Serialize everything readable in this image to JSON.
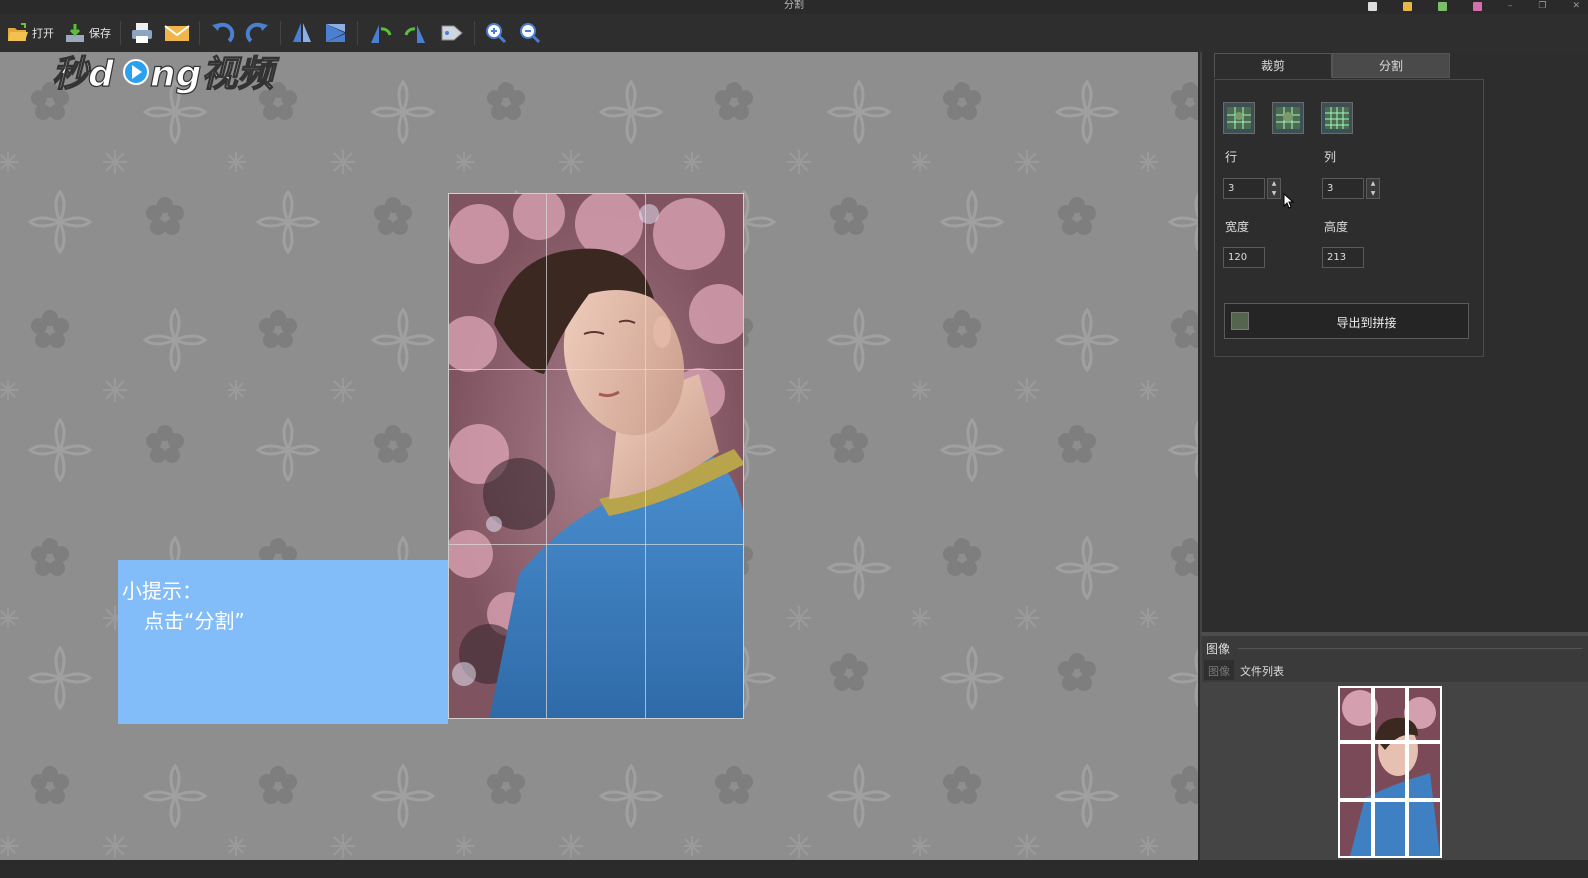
{
  "window": {
    "title": "分割"
  },
  "toolbar": {
    "open_label": "打开",
    "save_label": "保存"
  },
  "watermark": {
    "text": "秒懂视频"
  },
  "tip": {
    "title": "小提示：",
    "body": "点击“分割”"
  },
  "right_panel": {
    "tabs": [
      {
        "label": "裁剪",
        "active": true
      },
      {
        "label": "分割",
        "active": false
      }
    ],
    "rows_label": "行",
    "cols_label": "列",
    "rows_value": "3",
    "cols_value": "3",
    "width_label": "宽度",
    "height_label": "高度",
    "width_value": "120",
    "height_value": "213",
    "export_label": "导出到拼接"
  },
  "image_panel": {
    "title": "图像",
    "tabs": [
      {
        "label": "图像"
      },
      {
        "label": "文件列表"
      }
    ]
  },
  "split": {
    "rows": 3,
    "cols": 3
  },
  "colors": {
    "canvas_bg": "#8e8e8e",
    "tip_bg": "#82bdf9",
    "sweater": "#3d7fc0",
    "blossom": "#c78fa0"
  }
}
